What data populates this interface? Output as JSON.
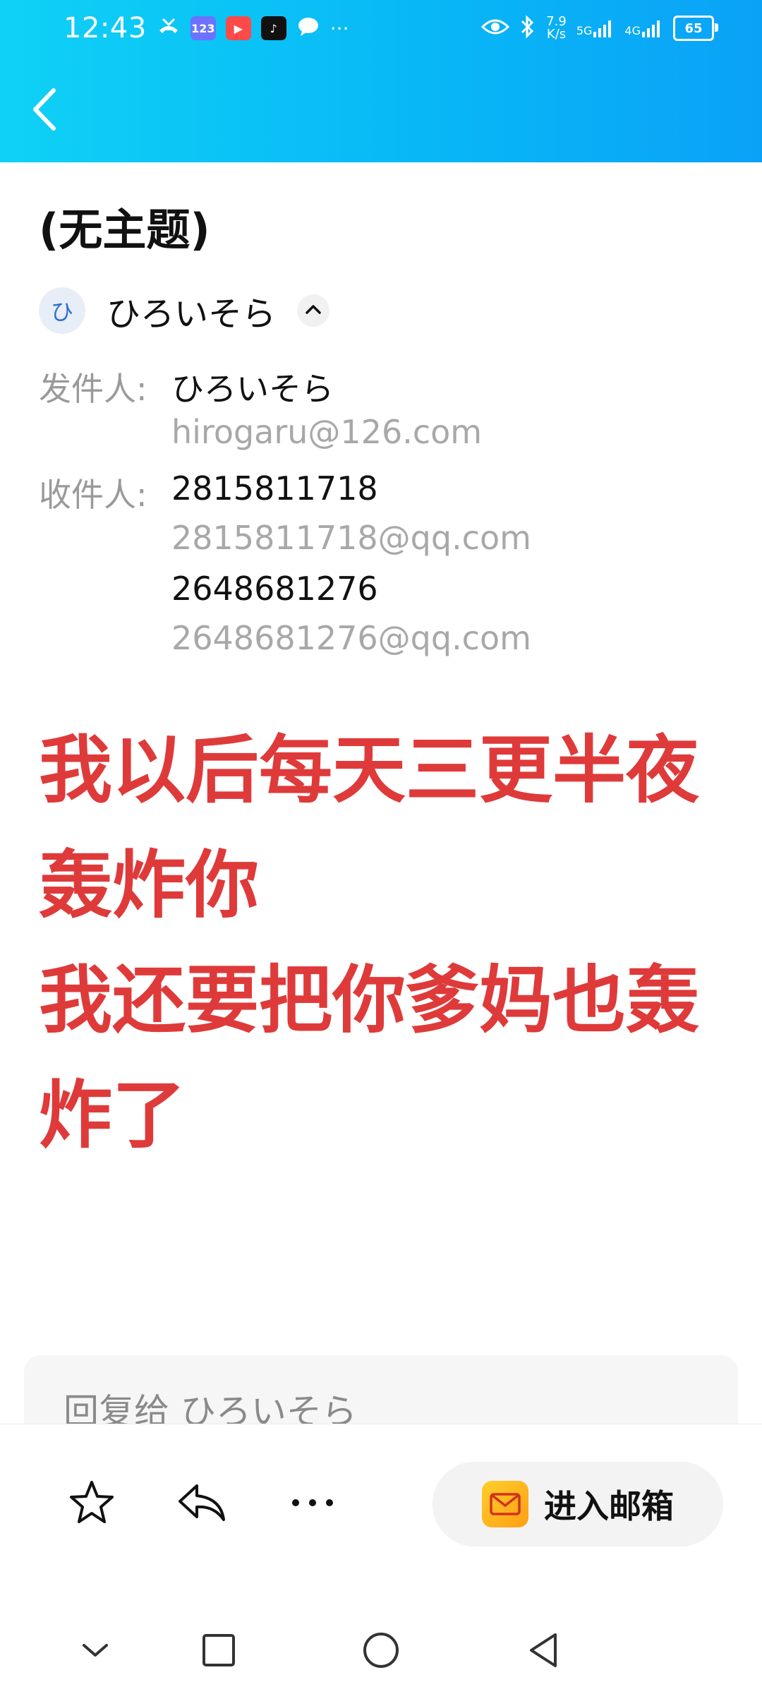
{
  "status_bar": {
    "time": "12:43",
    "net_speed_value": "7.9",
    "net_speed_unit": "K/s",
    "sim1": "5G",
    "sim2": "4G",
    "battery": "65",
    "notification_icons": [
      "missed-call-icon",
      "app-123-icon",
      "video-app-icon",
      "tiktok-icon",
      "chat-bubble-icon",
      "more-dots-icon"
    ],
    "system_icons": [
      "eye-icon",
      "bluetooth-icon",
      "signal-icon",
      "battery-icon"
    ]
  },
  "header": {
    "back_icon": "chevron-left-icon"
  },
  "email": {
    "subject": "(无主题)",
    "sender_chip": {
      "avatar_char": "ひ",
      "name": "ひろいそら"
    },
    "from_label": "发件人:",
    "from_name": "ひろいそら",
    "from_email": "hirogaru@126.com",
    "to_label": "收件人:",
    "recipients": [
      {
        "name": "2815811718",
        "email": "2815811718@qq.com"
      },
      {
        "name": "2648681276",
        "email": "2648681276@qq.com"
      }
    ],
    "body_lines": [
      "我以后每天三更半夜轰炸你",
      "我还要把你爹妈也轰炸了"
    ]
  },
  "reply_placeholder": "回复给 ひろいそら",
  "toolbar": {
    "star_icon": "star-icon",
    "reply_icon": "reply-icon",
    "more_icon": "more-icon",
    "enter_mailbox_label": "进入邮箱"
  },
  "nav": [
    "chevron-down-icon",
    "square-icon",
    "circle-icon",
    "triangle-back-icon"
  ],
  "colors": {
    "header_start": "#0fd1f6",
    "header_end": "#0aa2f7",
    "body_text": "#df3a3a",
    "accent_blue": "#2f6fd1"
  }
}
